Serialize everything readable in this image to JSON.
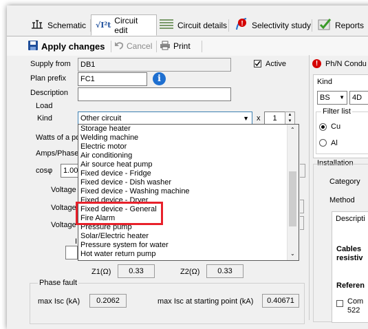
{
  "tabs": [
    {
      "label": "Schematic",
      "icon": "schematic-icon"
    },
    {
      "label": "Circuit edit",
      "icon": "sqrt-formula-icon",
      "icon_text": "√I²t"
    },
    {
      "label": "Circuit details",
      "icon": "list-lines-icon"
    },
    {
      "label": "Selectivity study",
      "icon": "selectivity-icon"
    },
    {
      "label": "Reports",
      "icon": "checkmark-report-icon"
    }
  ],
  "toolbar": {
    "apply_label": "Apply changes",
    "cancel_label": "Cancel",
    "print_label": "Print"
  },
  "form": {
    "supply_from_label": "Supply from",
    "supply_from_value": "DB1",
    "active_label": "Active",
    "active_checked": true,
    "plan_prefix_label": "Plan prefix",
    "plan_prefix_value": "FC1",
    "description_label": "Description",
    "description_value": "",
    "load_group_label": "Load",
    "kind_label": "Kind",
    "kind_value": "Other circuit",
    "multiplier_symbol": "x",
    "multiplier_value": "1",
    "watts_label": "Watts of a po",
    "amps_label": "Amps/Phase (",
    "cosphi_label": "cosφ",
    "cosphi_value": "1.00",
    "voltage_label_1": "Voltage",
    "voltage_label_2": "Voltage",
    "voltage_label_3": "Voltage",
    "z1_label": "Z1(Ω)",
    "z1_value": "0.33",
    "z2_label": "Z2(Ω)",
    "z2_value": "0.33",
    "ii_label": "I"
  },
  "dropdown_items": [
    "Storage heater",
    "Welding machine",
    "Electric motor",
    "Air conditioning",
    "Air source heat pump",
    "Fixed device - Fridge",
    "Fixed device - Dish washer",
    "Fixed device - Washing machine",
    "Fixed device - Dryer",
    "Fixed device - General",
    "Fire Alarm",
    "Pressure pump",
    "Solar/Electric heater",
    "Pressure system for water",
    "Hot water return pump"
  ],
  "phase_fault": {
    "group_label": "Phase fault",
    "max_isc_label": "max Isc (kA)",
    "max_isc_value": "0.2062",
    "max_isc_start_label": "max Isc at starting point (kA)",
    "max_isc_start_value": "0.40671"
  },
  "right_panel": {
    "phn_label": "Ph/N Condu",
    "kind_label": "Kind",
    "kind_value": "BS",
    "kind_value2": "4D",
    "filter_label": "Filter list",
    "radio_cu": "Cu",
    "radio_al": "Al",
    "installation_label": "Installation",
    "category_label": "Category",
    "method_label": "Method",
    "descr_label": "Descripti",
    "cables_label": "Cables",
    "resistive_label": "resistiv",
    "reference_label": "Referen",
    "comp_label": "Com",
    "comp_num": "522"
  },
  "colors": {
    "highlight": "#e8202a",
    "info_blue": "#1e6fd0",
    "warning_red": "#d40000"
  }
}
